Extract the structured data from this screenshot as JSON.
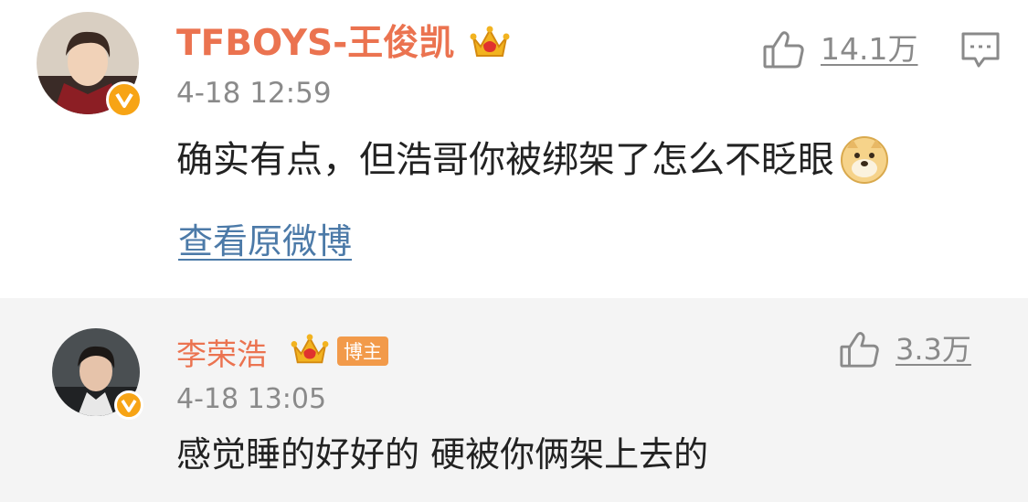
{
  "comments": [
    {
      "username": "TFBOYS-王俊凯",
      "timestamp": "4-18 12:59",
      "text": "确实有点，但浩哥你被绑架了怎么不眨眼",
      "view_original": "查看原微博",
      "likes": "14.1万",
      "crown_icon": "crown-icon",
      "verified_icon": "verified-v-icon",
      "emoji_icon": "doge-emoji-icon"
    },
    {
      "username": "李荣浩",
      "owner_badge": "博主",
      "timestamp": "4-18 13:05",
      "text": "感觉睡的好好的 硬被你俩架上去的",
      "likes": "3.3万",
      "crown_icon": "crown-icon",
      "verified_icon": "verified-v-icon"
    }
  ],
  "colors": {
    "username": "#eb7350",
    "timestamp": "#8a8a8a",
    "link": "#4c7aa8",
    "verified_badge": "#f7a415",
    "owner_badge": "#f29a4a",
    "second_row_bg": "#f4f4f4"
  }
}
